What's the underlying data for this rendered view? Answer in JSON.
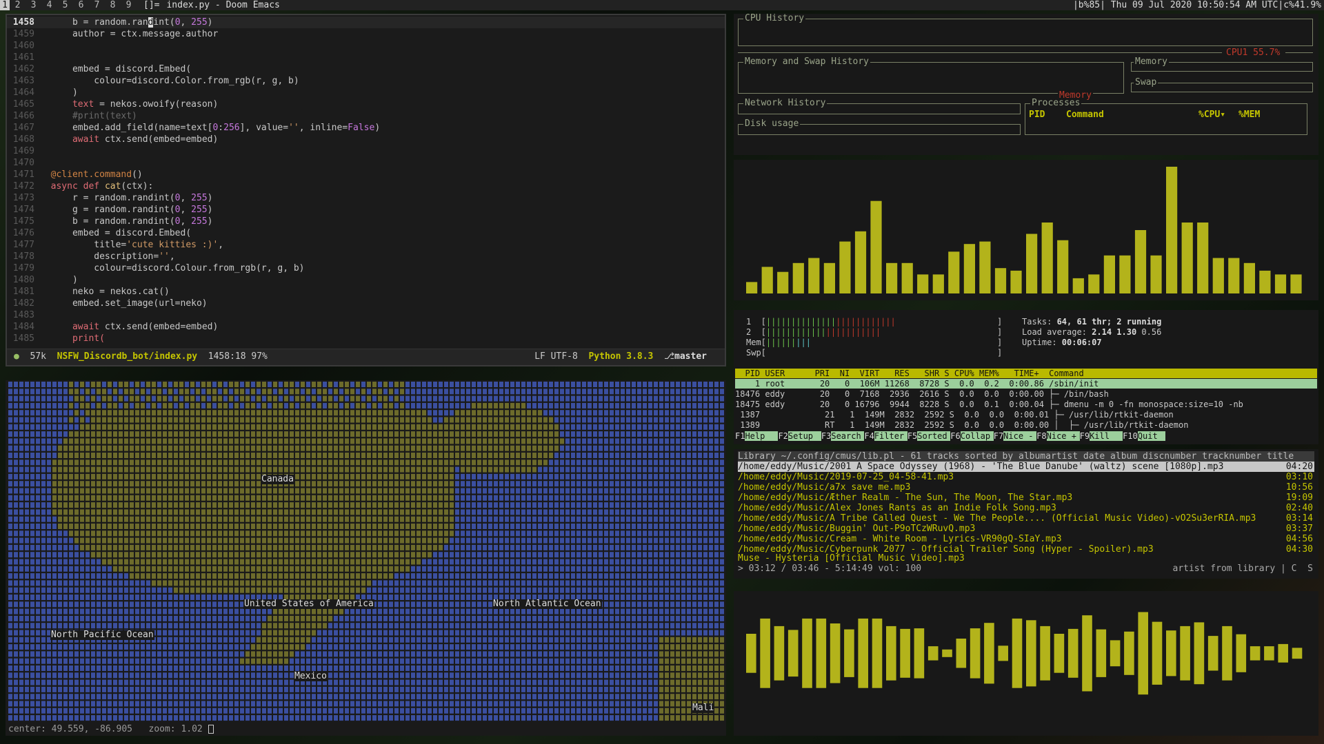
{
  "topbar": {
    "tags": [
      "1",
      "2",
      "3",
      "4",
      "5",
      "6",
      "7",
      "8",
      "9"
    ],
    "layout": "[]=",
    "window_title": "index.py - Doom Emacs",
    "status": "|b%85| Thu 09 Jul 2020 10:50:54 AM UTC|c%41.9%"
  },
  "emacs": {
    "lines": [
      {
        "n": "1458",
        "cur": true,
        "parts": [
          [
            "",
            "    b = random.ran"
          ],
          [
            "",
            "dint("
          ],
          [
            "num",
            "0"
          ],
          [
            "",
            ", "
          ],
          [
            "num",
            "255"
          ],
          [
            "",
            ")"
          ]
        ]
      },
      {
        "n": "1459",
        "parts": [
          [
            "",
            "    author = ctx.message.author"
          ]
        ]
      },
      {
        "n": "1460",
        "parts": []
      },
      {
        "n": "1461",
        "parts": []
      },
      {
        "n": "1462",
        "parts": [
          [
            "",
            "    embed = discord.Embed("
          ]
        ]
      },
      {
        "n": "1463",
        "parts": [
          [
            "",
            "        colour=discord.Color.from_rgb(r, g, b)"
          ]
        ]
      },
      {
        "n": "1464",
        "parts": [
          [
            "",
            "    )"
          ]
        ]
      },
      {
        "n": "1465",
        "parts": [
          [
            "",
            "    "
          ],
          [
            "kw",
            "text"
          ],
          [
            "",
            " = nekos.owoify(reason)"
          ]
        ]
      },
      {
        "n": "1466",
        "parts": [
          [
            "cmt",
            "    #print(text)"
          ]
        ]
      },
      {
        "n": "1467",
        "parts": [
          [
            "",
            "    embed.add_field(name=text["
          ],
          [
            "num",
            "0"
          ],
          [
            "",
            ":"
          ],
          [
            "num",
            "256"
          ],
          [
            "",
            "], value="
          ],
          [
            "str",
            "''"
          ],
          [
            "",
            ", inline="
          ],
          [
            "num",
            "False"
          ],
          [
            "",
            ")"
          ]
        ]
      },
      {
        "n": "1468",
        "parts": [
          [
            "kw",
            "    await"
          ],
          [
            "",
            " ctx.send(embed=embed)"
          ]
        ]
      },
      {
        "n": "1469",
        "parts": []
      },
      {
        "n": "1470",
        "parts": []
      },
      {
        "n": "1471",
        "parts": [
          [
            "dec",
            "@client.command"
          ],
          [
            "",
            "()"
          ]
        ]
      },
      {
        "n": "1472",
        "parts": [
          [
            "kw",
            "async def"
          ],
          [
            "",
            " "
          ],
          [
            "fn",
            "cat"
          ],
          [
            "",
            "(ctx):"
          ]
        ]
      },
      {
        "n": "1473",
        "parts": [
          [
            "",
            "    r = random.randint("
          ],
          [
            "num",
            "0"
          ],
          [
            "",
            ", "
          ],
          [
            "num",
            "255"
          ],
          [
            "",
            ")"
          ]
        ]
      },
      {
        "n": "1474",
        "parts": [
          [
            "",
            "    g = random.randint("
          ],
          [
            "num",
            "0"
          ],
          [
            "",
            ", "
          ],
          [
            "num",
            "255"
          ],
          [
            "",
            ")"
          ]
        ]
      },
      {
        "n": "1475",
        "parts": [
          [
            "",
            "    b = random.randint("
          ],
          [
            "num",
            "0"
          ],
          [
            "",
            ", "
          ],
          [
            "num",
            "255"
          ],
          [
            "",
            ")"
          ]
        ]
      },
      {
        "n": "1476",
        "parts": [
          [
            "",
            "    embed = discord.Embed("
          ]
        ]
      },
      {
        "n": "1477",
        "parts": [
          [
            "",
            "        title="
          ],
          [
            "str",
            "'cute kitties :)'"
          ],
          [
            "",
            ","
          ]
        ]
      },
      {
        "n": "1478",
        "parts": [
          [
            "",
            "        description="
          ],
          [
            "str",
            "''"
          ],
          [
            "",
            ","
          ]
        ]
      },
      {
        "n": "1479",
        "parts": [
          [
            "",
            "        colour=discord.Colour.from_rgb(r, g, b)"
          ]
        ]
      },
      {
        "n": "1480",
        "parts": [
          [
            "",
            "    )"
          ]
        ]
      },
      {
        "n": "1481",
        "parts": [
          [
            "",
            "    neko = nekos.cat()"
          ]
        ]
      },
      {
        "n": "1482",
        "parts": [
          [
            "",
            "    embed.set_image(url=neko)"
          ]
        ]
      },
      {
        "n": "1483",
        "parts": []
      },
      {
        "n": "1484",
        "parts": [
          [
            "kw",
            "    await"
          ],
          [
            "",
            " ctx.send(embed=embed)"
          ]
        ]
      },
      {
        "n": "1485",
        "parts": [
          [
            "kw",
            "    print("
          ]
        ]
      }
    ],
    "modeline": {
      "size": "57k",
      "file": "NSFW_Discordb_bot/index.py",
      "position": "1458:18 97%",
      "encoding": "LF UTF-8",
      "mode": "Python 3.8.3",
      "branch": "master"
    }
  },
  "map": {
    "labels": {
      "canada": "Canada",
      "usa": "United States of America",
      "north_atlantic": "North Atlantic Ocean",
      "north_pacific": "North Pacific Ocean",
      "mexico": "Mexico",
      "mali": "Mali"
    },
    "status": "center: 49.559, -86.905   zoom: 1.02 "
  },
  "gotop": {
    "cpu_history": "CPU History",
    "cpu_label": "CPU1",
    "cpu_value": "55.7%",
    "mem_swap_history": "Memory and Swap History",
    "memory": "Memory",
    "swap": "Swap",
    "memory_graph_label": "Memory",
    "network_history": "Network History",
    "processes": "Processes",
    "disk_usage": "Disk usage",
    "proc_cols": [
      "PID",
      "Command",
      "%CPU▾",
      "%MEM"
    ]
  },
  "cava1": {
    "levels": [
      0.09,
      0.21,
      0.17,
      0.24,
      0.28,
      0.24,
      0.41,
      0.49,
      0.73,
      0.24,
      0.24,
      0.15,
      0.15,
      0.33,
      0.39,
      0.41,
      0.2,
      0.18,
      0.47,
      0.56,
      0.42,
      0.12,
      0.15,
      0.3,
      0.3,
      0.5,
      0.3,
      1.0,
      0.56,
      0.56,
      0.28,
      0.28,
      0.24,
      0.18,
      0.15,
      0.15
    ],
    "color": "#b3b31b"
  },
  "htop": {
    "cpu1": "1  [",
    "cpu2": "2  [",
    "mem": "Mem[",
    "swp": "Swp[",
    "tasks_label": "Tasks: ",
    "tasks_val": "64, 61 thr; 2 running",
    "load_label": "Load average: ",
    "load_val": "2.14 1.30 ",
    "load_val3": "0.56",
    "uptime_label": "Uptime: ",
    "uptime_val": "00:06:07",
    "header": "  PID USER      PRI  NI  VIRT   RES   SHR S CPU% MEM%   TIME+  Command",
    "rows": [
      "    1 root       20   0  106M 11268  8728 S  0.0  0.2  0:00.86 /sbin/init",
      "18476 eddy       20   0  7168  2936  2616 S  0.0  0.0  0:00.00 ├─ /bin/bash",
      "18475 eddy       20   0 16796  9944  8228 S  0.0  0.1  0:00.04 ├─ dmenu -m 0 -fn monospace:size=10 -nb",
      " 1387             21   1  149M  2832  2592 S  0.0  0.0  0:00.01 ├─ /usr/lib/rtkit-daemon",
      " 1389             RT   1  149M  2832  2592 S  0.0  0.0  0:00.00 │  ├─ /usr/lib/rtkit-daemon"
    ],
    "fkeys": [
      [
        "F1",
        "Help"
      ],
      [
        "F2",
        "Setup"
      ],
      [
        "F3",
        "Search"
      ],
      [
        "F4",
        "Filter"
      ],
      [
        "F5",
        "Sorted"
      ],
      [
        "F6",
        "Collap"
      ],
      [
        "F7",
        "Nice -"
      ],
      [
        "F8",
        "Nice +"
      ],
      [
        "F9",
        "Kill"
      ],
      [
        "F10",
        "Quit"
      ]
    ]
  },
  "cmus": {
    "header": "Library ~/.config/cmus/lib.pl - 61 tracks sorted by albumartist date album discnumber tracknumber title",
    "tracks": [
      {
        "t": "/home/eddy/Music/2001 A Space Odyssey (1968) - 'The Blue Danube' (waltz) scene [1080p].mp3",
        "d": "04:20"
      },
      {
        "t": "/home/eddy/Music/2019-07-25_04-58-41.mp3",
        "d": "03:10"
      },
      {
        "t": "/home/eddy/Music/a7x save me.mp3",
        "d": "10:56"
      },
      {
        "t": "/home/eddy/Music/Æther Realm - The Sun, The Moon, The Star.mp3",
        "d": "19:09"
      },
      {
        "t": "/home/eddy/Music/Alex Jones Rants as an Indie Folk Song.mp3",
        "d": "02:40"
      },
      {
        "t": "/home/eddy/Music/A Tribe Called Quest - We The People.... (Official Music Video)-vO2Su3erRIA.mp3",
        "d": "03:14"
      },
      {
        "t": "/home/eddy/Music/Buggin' Out-P9oTCzWRuvQ.mp3",
        "d": "03:37"
      },
      {
        "t": "/home/eddy/Music/Cream - White Room - Lyrics-VR90gQ-SIaY.mp3",
        "d": "04:56"
      },
      {
        "t": "/home/eddy/Music/Cyberpunk 2077 - Official Trailer Song (Hyper - Spoiler).mp3",
        "d": "04:30"
      }
    ],
    "now_playing": "Muse - Hysteria [Official Music Video].mp3",
    "progress": "> 03:12 / 03:46 - 5:14:49 vol: 100",
    "mode": "artist from library | C  S"
  },
  "cava2": {
    "levels": [
      0.36,
      0.64,
      0.5,
      0.43,
      0.64,
      0.64,
      0.55,
      0.44,
      0.64,
      0.64,
      0.5,
      0.45,
      0.46,
      0.13,
      0.07,
      0.27,
      0.46,
      0.56,
      0.14,
      0.64,
      0.61,
      0.5,
      0.36,
      0.45,
      0.7,
      0.44,
      0.24,
      0.4,
      0.76,
      0.58,
      0.42,
      0.5,
      0.57,
      0.32,
      0.5,
      0.35,
      0.13,
      0.13,
      0.17,
      0.1
    ],
    "color": "#b3b31b"
  }
}
